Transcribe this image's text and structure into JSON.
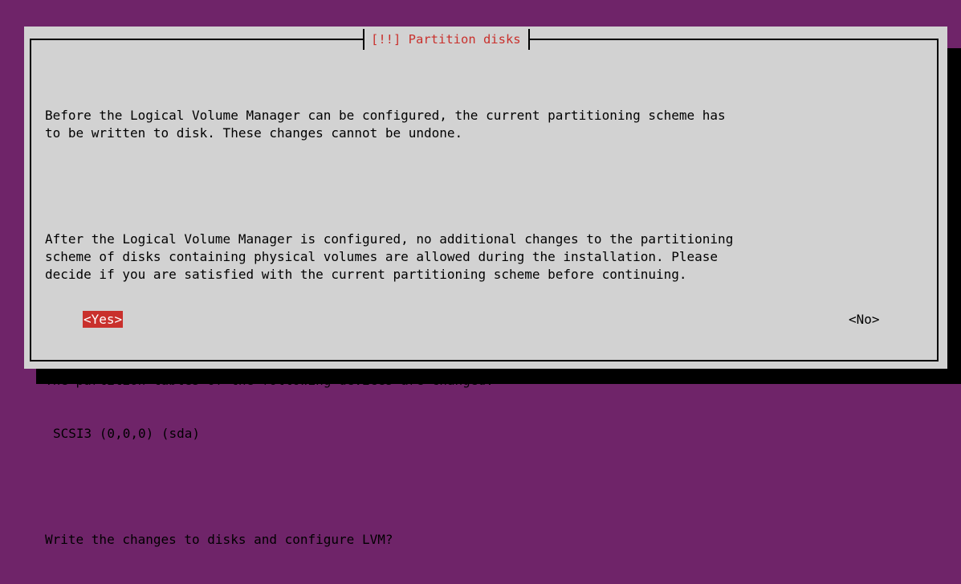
{
  "dialog": {
    "title": "[!!] Partition disks",
    "paragraph1": "Before the Logical Volume Manager can be configured, the current partitioning scheme has\nto be written to disk. These changes cannot be undone.",
    "paragraph2": "After the Logical Volume Manager is configured, no additional changes to the partitioning\nscheme of disks containing physical volumes are allowed during the installation. Please\ndecide if you are satisfied with the current partitioning scheme before continuing.",
    "paragraph3": "The partition tables of the following devices are changed:",
    "device": "SCSI3 (0,0,0) (sda)",
    "question": "Write the changes to disks and configure LVM?",
    "buttons": {
      "yes": "<Yes>",
      "no": "<No>"
    }
  },
  "colors": {
    "background": "#6f2469",
    "dialog": "#d2d2d2",
    "title_text": "#c9302c",
    "selected_button": "#c9302c",
    "shadow": "#000000"
  }
}
